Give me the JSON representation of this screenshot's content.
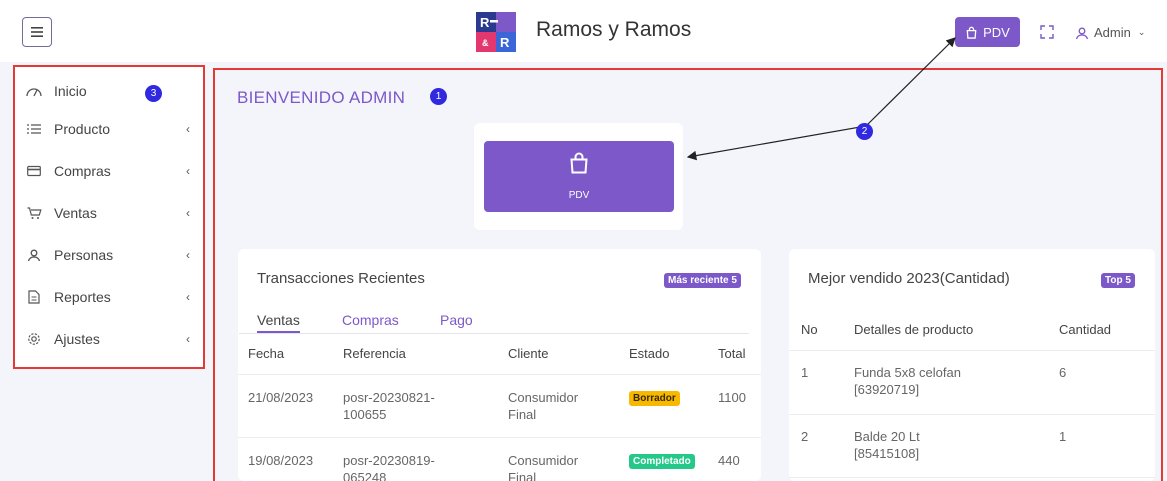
{
  "header": {
    "brand": "Ramos y Ramos",
    "logo_text": "R&R",
    "pdv_label": "PDV",
    "user_label": "Admin"
  },
  "sidebar": {
    "items": [
      {
        "label": "Inicio",
        "icon": "dashboard-gauge-icon",
        "has_children": false
      },
      {
        "label": "Producto",
        "icon": "list-icon",
        "has_children": true
      },
      {
        "label": "Compras",
        "icon": "credit-card-icon",
        "has_children": true
      },
      {
        "label": "Ventas",
        "icon": "cart-icon",
        "has_children": true
      },
      {
        "label": "Personas",
        "icon": "user-icon",
        "has_children": true
      },
      {
        "label": "Reportes",
        "icon": "file-icon",
        "has_children": true
      },
      {
        "label": "Ajustes",
        "icon": "gear-icon",
        "has_children": true
      }
    ],
    "annotation_badge": "3"
  },
  "main": {
    "welcome": "BIENVENIDO ADMIN",
    "welcome_badge": "1",
    "arrow_badge": "2",
    "pdv_button_label": "PDV"
  },
  "transactions": {
    "title": "Transacciones Recientes",
    "pill": "Más reciente 5",
    "tabs": [
      "Ventas",
      "Compras",
      "Pago"
    ],
    "active_tab": "Ventas",
    "columns": [
      "Fecha",
      "Referencia",
      "Cliente",
      "Estado",
      "Total"
    ],
    "rows": [
      {
        "fecha": "21/08/2023",
        "ref1": "posr-20230821-",
        "ref2": "100655",
        "cli1": "Consumidor",
        "cli2": "Final",
        "estado": "Borrador",
        "total": "1100"
      },
      {
        "fecha": "19/08/2023",
        "ref1": "posr-20230819-",
        "ref2": "065248",
        "cli1": "Consumidor",
        "cli2": "Final",
        "estado": "Completado",
        "total": "440"
      }
    ]
  },
  "best_sellers": {
    "title": "Mejor vendido 2023(Cantidad)",
    "pill": "Top 5",
    "columns": [
      "No",
      "Detalles de producto",
      "Cantidad"
    ],
    "rows": [
      {
        "no": "1",
        "name": "Funda 5x8 celofan",
        "code": "[63920719]",
        "qty": "6"
      },
      {
        "no": "2",
        "name": "Balde 20 Lt",
        "code": "[85415108]",
        "qty": "1"
      }
    ]
  },
  "colors": {
    "accent": "#7c58c9",
    "annotation_red": "#e53935",
    "badge_blue": "#3029e0",
    "draft": "#f6b800",
    "completed": "#24c98a"
  }
}
